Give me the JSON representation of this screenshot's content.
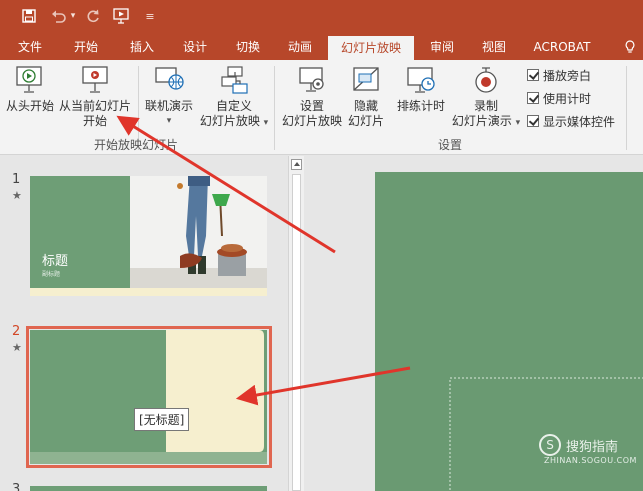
{
  "quick_access": {
    "items": [
      "save-icon",
      "undo-icon",
      "redo-icon",
      "start-from-beginning-icon",
      "customize-icon"
    ]
  },
  "tabs": [
    {
      "label": "文件"
    },
    {
      "label": "开始"
    },
    {
      "label": "插入"
    },
    {
      "label": "设计"
    },
    {
      "label": "切换"
    },
    {
      "label": "动画"
    },
    {
      "label": "幻灯片放映",
      "active": true
    },
    {
      "label": "审阅"
    },
    {
      "label": "视图"
    },
    {
      "label": "ACROBAT"
    }
  ],
  "ribbon": {
    "start_group": {
      "label": "开始放映幻灯片",
      "from_beginning": "从头开始",
      "from_current_line1": "从当前幻灯片",
      "from_current_line2": "开始",
      "online_present": "联机演示",
      "custom_show_line1": "自定义",
      "custom_show_line2": "幻灯片放映"
    },
    "setup_group": {
      "label": "设置",
      "setup_show_line1": "设置",
      "setup_show_line2": "幻灯片放映",
      "hide_slide_line1": "隐藏",
      "hide_slide_line2": "幻灯片",
      "rehearse": "排练计时",
      "record_line1": "录制",
      "record_line2": "幻灯片演示"
    },
    "checkboxes": [
      {
        "label": "播放旁白",
        "checked": true
      },
      {
        "label": "使用计时",
        "checked": true
      },
      {
        "label": "显示媒体控件",
        "checked": true
      }
    ]
  },
  "slides": [
    {
      "number": "1",
      "title": "标题",
      "subtitle": "副标题"
    },
    {
      "number": "2",
      "selected": true
    },
    {
      "number": "3"
    }
  ],
  "tooltip": "[无标题]",
  "watermark": {
    "brand": "搜狗指南",
    "url": "ZHINAN.SOGOU.COM"
  },
  "colors": {
    "brand": "#b7472a",
    "slide_green": "#6e9e76",
    "annotation_red": "#e0352b",
    "selection": "#e06650"
  }
}
